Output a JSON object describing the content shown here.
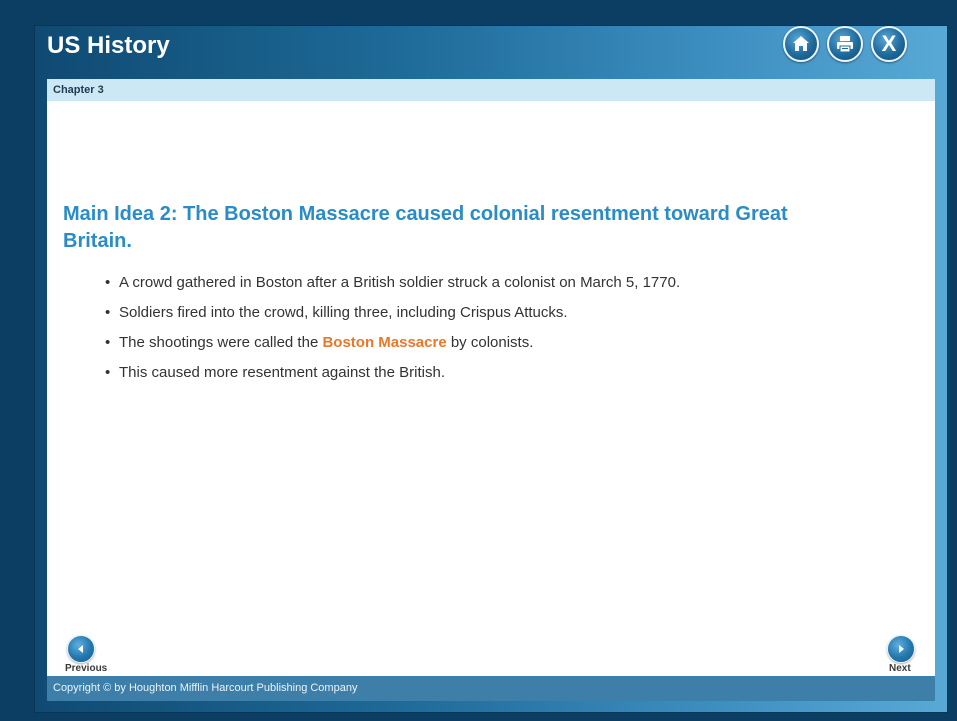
{
  "header": {
    "title": "US History",
    "icons": [
      "home-icon",
      "print-icon",
      "close-icon"
    ],
    "close_glyph": "X"
  },
  "chapter_bar": {
    "label": "Chapter 3"
  },
  "main": {
    "heading": "Main Idea 2: The Boston Massacre caused colonial resentment toward Great Britain.",
    "bullets": [
      {
        "text": "A crowd gathered in Boston after a British soldier struck a colonist on March 5, 1770."
      },
      {
        "text": "Soldiers fired into the crowd, killing three, including Crispus Attucks."
      },
      {
        "before": "The shootings were called the ",
        "highlight": "Boston Massacre",
        "after": " by colonists."
      },
      {
        "text": "This caused more resentment against the British."
      }
    ],
    "highlight_color": "#e8782a",
    "heading_color": "#2a8cc6"
  },
  "nav": {
    "previous_label": "Previous",
    "next_label": "Next"
  },
  "footer": {
    "copyright": "Copyright © by Houghton Mifflin Harcourt Publishing Company"
  },
  "colors": {
    "frame": "#0c3d63",
    "header_gradient_start": "#0f4a73",
    "header_gradient_end": "#59a9d6",
    "chapter_bar": "#cde8f5",
    "footer": "#3d7fa8"
  }
}
